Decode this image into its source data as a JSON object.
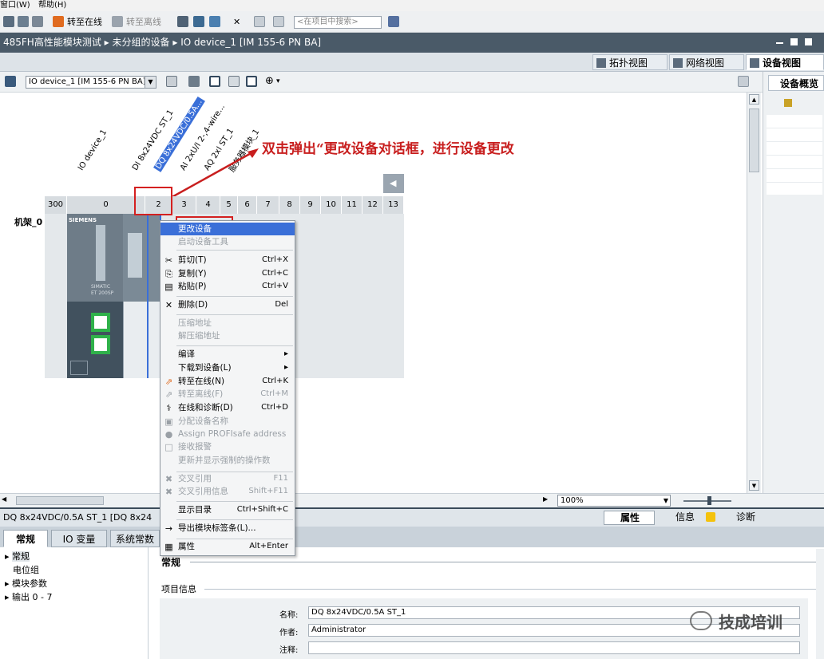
{
  "menubar": {
    "window": "窗口(W)",
    "help": "帮助(H)"
  },
  "toolbar": {
    "go_online": "转至在线",
    "go_offline": "转至离线",
    "search_placeholder": "<在项目中搜索>"
  },
  "breadcrumb": {
    "project": "485FH高性能模块测试",
    "group": "未分组的设备",
    "device": "IO device_1 [IM 155-6 PN BA]"
  },
  "view_tabs": {
    "topology": "拓扑视图",
    "network": "网络视图",
    "device": "设备视图"
  },
  "device_toolbar": {
    "device_select": "IO device_1 [IM 155-6 PN BA]"
  },
  "right_panel": {
    "title": "设备概览"
  },
  "rack": {
    "label": "机架_0",
    "slots": [
      "300",
      "0",
      "2",
      "3",
      "4",
      "5",
      "6",
      "7",
      "8",
      "9",
      "10",
      "11",
      "12",
      "13"
    ],
    "module_labels": [
      "IO device_1",
      "DI 8x24VDC ST_1",
      "DQ 8x24VDC/0.5A...",
      "AI 2xU/I 2-,4-wire...",
      "AQ 2xI ST_1",
      "服务器模块_1"
    ],
    "head_brand": "SIEMENS",
    "head_text_1": "SIMATIC",
    "head_text_2": "ET 200SP"
  },
  "annotation": "双击弹出“更改设备对话框，进行设备更改",
  "context_menu": {
    "items": [
      {
        "label": "更改设备",
        "shortcut": ""
      },
      {
        "label": "启动设备工具",
        "shortcut": ""
      },
      {
        "label": "剪切(T)",
        "shortcut": "Ctrl+X"
      },
      {
        "label": "复制(Y)",
        "shortcut": "Ctrl+C"
      },
      {
        "label": "粘贴(P)",
        "shortcut": "Ctrl+V"
      },
      {
        "label": "删除(D)",
        "shortcut": "Del"
      },
      {
        "label": "压缩地址",
        "shortcut": ""
      },
      {
        "label": "解压缩地址",
        "shortcut": ""
      },
      {
        "label": "编译",
        "shortcut": ""
      },
      {
        "label": "下载到设备(L)",
        "shortcut": ""
      },
      {
        "label": "转至在线(N)",
        "shortcut": "Ctrl+K"
      },
      {
        "label": "转至离线(F)",
        "shortcut": "Ctrl+M"
      },
      {
        "label": "在线和诊断(D)",
        "shortcut": "Ctrl+D"
      },
      {
        "label": "分配设备名称",
        "shortcut": ""
      },
      {
        "label": "Assign PROFIsafe address",
        "shortcut": ""
      },
      {
        "label": "接收报警",
        "shortcut": ""
      },
      {
        "label": "更新并显示强制的操作数",
        "shortcut": ""
      },
      {
        "label": "交叉引用",
        "shortcut": "F11"
      },
      {
        "label": "交叉引用信息",
        "shortcut": "Shift+F11"
      },
      {
        "label": "显示目录",
        "shortcut": "Ctrl+Shift+C"
      },
      {
        "label": "导出模块标签条(L)...",
        "shortcut": ""
      },
      {
        "label": "属性",
        "shortcut": "Alt+Enter"
      }
    ]
  },
  "zoom": {
    "value": "100%"
  },
  "properties": {
    "status_title": "DQ 8x24VDC/0.5A ST_1 [DQ 8x24",
    "tab_properties": "属性",
    "tab_info": "信息",
    "tab_diag": "诊断",
    "tabs": [
      "常规",
      "IO 变量",
      "系统常数"
    ],
    "tree": [
      "常规",
      "电位组",
      "模块参数",
      "输出 0 - 7"
    ],
    "section": "常规",
    "subsection": "项目信息",
    "name_label": "名称:",
    "name_value": "DQ 8x24VDC/0.5A ST_1",
    "author_label": "作者:",
    "author_value": "Administrator",
    "comment_label": "注释:"
  },
  "watermark": "技成培训"
}
